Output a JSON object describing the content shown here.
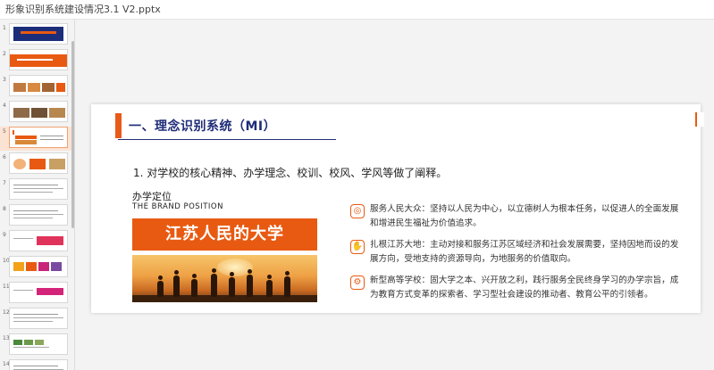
{
  "window": {
    "title": "形象识别系统建设情况3.1 V2.pptx"
  },
  "thumbnails": [
    {
      "num": "1",
      "style": "title-dark"
    },
    {
      "num": "2",
      "style": "orange-banner"
    },
    {
      "num": "3",
      "style": "photos"
    },
    {
      "num": "4",
      "style": "photos2"
    },
    {
      "num": "5",
      "style": "current"
    },
    {
      "num": "6",
      "style": "cards"
    },
    {
      "num": "7",
      "style": "text"
    },
    {
      "num": "8",
      "style": "text"
    },
    {
      "num": "9",
      "style": "red-row"
    },
    {
      "num": "10",
      "style": "color-row"
    },
    {
      "num": "11",
      "style": "pink-row"
    },
    {
      "num": "12",
      "style": "text"
    },
    {
      "num": "13",
      "style": "grid"
    },
    {
      "num": "14",
      "style": "text"
    }
  ],
  "slide": {
    "title": "一、理念识别系统（MI）",
    "intro": "1. 对学校的核心精神、办学理念、校训、校风、学风等做了阐释。",
    "position_cn": "办学定位",
    "position_en": "THE BRAND POSITION",
    "banner": "江苏人民的大学",
    "points": [
      {
        "text": "服务人民大众：坚持以人民为中心，以立德树人为根本任务，以促进人的全面发展和增进民生福祉为价值追求。"
      },
      {
        "text": "扎根江苏大地：主动对接和服务江苏区域经济和社会发展需要，坚持因地而设的发展方向，受地支持的资源导向，为地服务的价值取向。"
      },
      {
        "text": "新型高等学校：固大学之本、兴开放之利，践行服务全民终身学习的办学宗旨，成为教育方式变革的探索者、学习型社会建设的推动者、教育公平的引领者。"
      }
    ]
  },
  "colors": {
    "accent": "#e85a12",
    "title": "#1f2d78"
  }
}
